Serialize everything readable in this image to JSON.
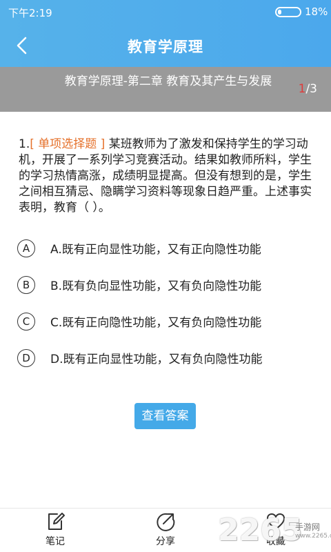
{
  "status": {
    "time": "下午2:19",
    "battery_percent_label": "18%",
    "battery_level": 0.18
  },
  "header": {
    "title": "教育学原理",
    "back_icon": "chevron-left-icon"
  },
  "chapter": {
    "name": "教育学原理-第二章 教育及其产生与发展",
    "current_page": "1",
    "total_pages": "/3",
    "current_color": "#e03b3b"
  },
  "question": {
    "number": "1.",
    "type": "[ 单项选择题 ]",
    "text": " 某班教师为了激发和保持学生的学习动机，开展了一系列学习竞赛活动。结果如教师所料，学生的学习热情高涨，成绩明显提高。但没有想到的是，学生之间相互猜忌、隐瞒学习资料等现象日趋严重。上述事实表明，教育（ ）。",
    "options": [
      {
        "key": "A",
        "text": "A.既有正向显性功能，又有正向隐性功能"
      },
      {
        "key": "B",
        "text": "B.既有负向显性功能，又有负向隐性功能"
      },
      {
        "key": "C",
        "text": "C.既有正向隐性功能，又有负向隐性功能"
      },
      {
        "key": "D",
        "text": "D.既有正向显性功能，又有负向隐性功能"
      }
    ]
  },
  "answer_button": "查看答案",
  "bottom_nav": [
    {
      "label": "笔记",
      "icon": "edit-note-icon"
    },
    {
      "label": "分享",
      "icon": "share-icon"
    },
    {
      "label": "收藏",
      "icon": "heart-icon"
    }
  ],
  "watermark": {
    "big": "2265",
    "small": "手游网",
    "url": "www.2265.com"
  },
  "colors": {
    "accent": "#4ba8ec",
    "chapter_bar": "#9a9a9a",
    "question_type": "#e5702a",
    "button": "#44a9e8"
  }
}
